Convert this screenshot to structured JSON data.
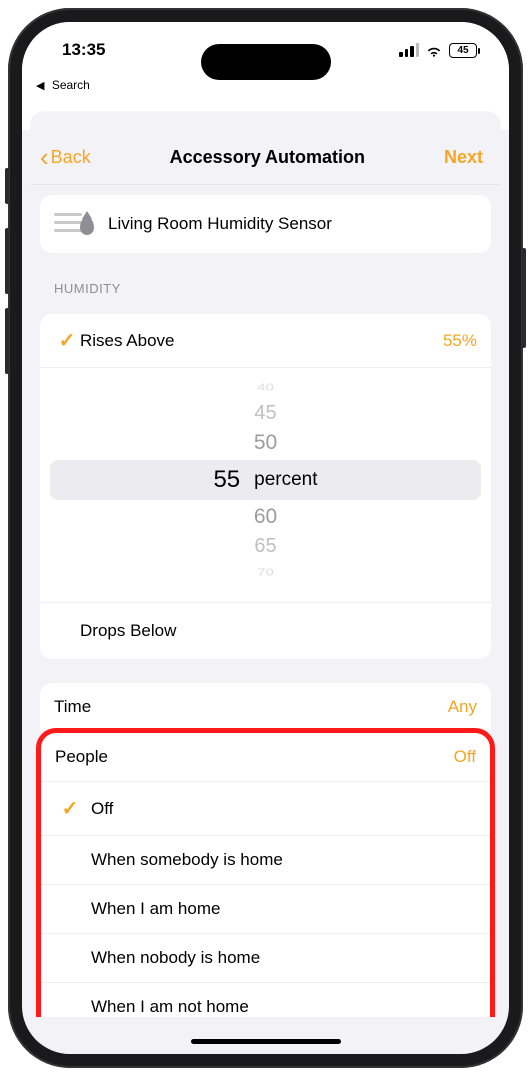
{
  "status": {
    "time": "13:35",
    "battery": "45",
    "back_search": "Search"
  },
  "nav": {
    "back": "Back",
    "title": "Accessory Automation",
    "next": "Next"
  },
  "sensor": {
    "name": "Living Room Humidity Sensor"
  },
  "humidity": {
    "section_label": "HUMIDITY",
    "rises_label": "Rises Above",
    "rises_value": "55%",
    "drops_label": "Drops Below",
    "picker": {
      "options": [
        "40",
        "45",
        "50",
        "55",
        "60",
        "65",
        "70"
      ],
      "selected": "55",
      "unit": "percent"
    }
  },
  "time_row": {
    "label": "Time",
    "value": "Any"
  },
  "people": {
    "label": "People",
    "value": "Off",
    "options": [
      {
        "label": "Off",
        "selected": true
      },
      {
        "label": "When somebody is home",
        "selected": false
      },
      {
        "label": "When I am home",
        "selected": false
      },
      {
        "label": "When nobody is home",
        "selected": false
      },
      {
        "label": "When I am not home",
        "selected": false
      }
    ]
  }
}
